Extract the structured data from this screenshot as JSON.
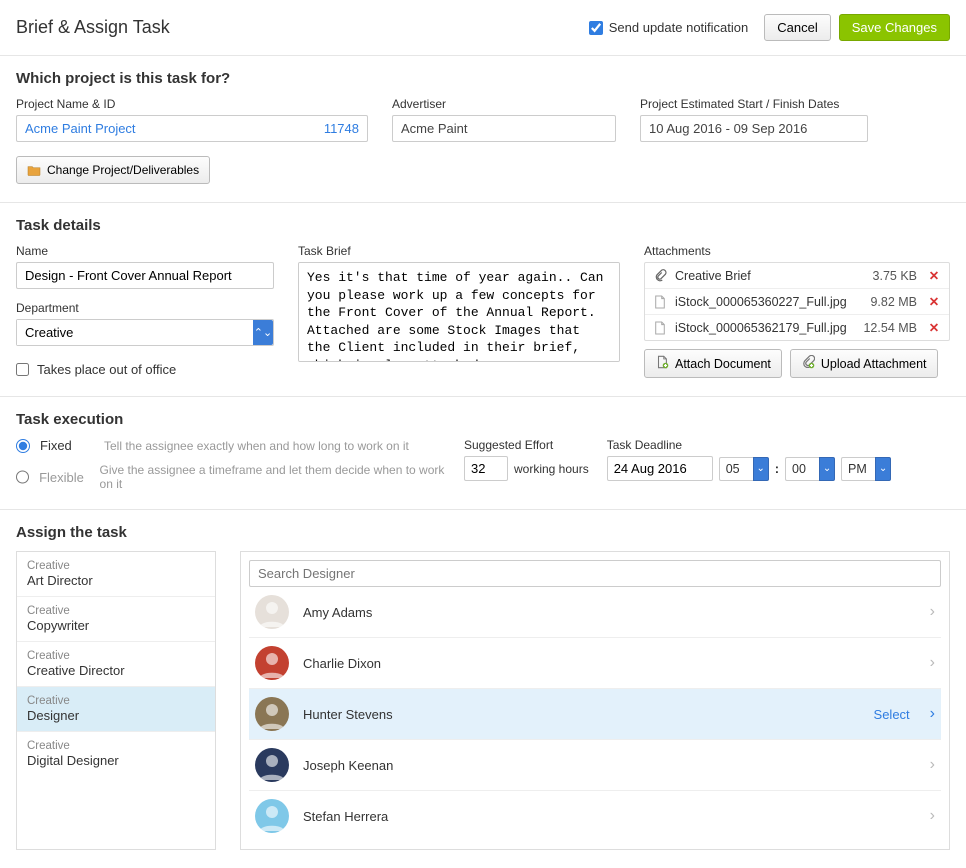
{
  "header": {
    "title": "Brief & Assign Task",
    "notify_label": "Send update notification",
    "notify_checked": true,
    "cancel": "Cancel",
    "save": "Save Changes"
  },
  "project_section": {
    "heading": "Which project is this task for?",
    "name_label": "Project Name & ID",
    "project_name": "Acme Paint Project",
    "project_id": "11748",
    "advertiser_label": "Advertiser",
    "advertiser": "Acme Paint",
    "dates_label": "Project Estimated Start / Finish Dates",
    "dates": "10 Aug 2016 - 09 Sep 2016",
    "change_btn": "Change Project/Deliverables"
  },
  "details": {
    "heading": "Task details",
    "name_label": "Name",
    "name_value": "Design - Front Cover Annual Report",
    "dept_label": "Department",
    "dept_value": "Creative",
    "brief_label": "Task Brief",
    "brief_text": "Yes it's that time of year again.. Can you please work up a few concepts for the Front Cover of the Annual Report. Attached are some Stock Images that the Client included in their brief, which is also attached.\n\nWe need this by the end of next Wednesday so please callout if you need help or input. Also, don't spend more",
    "out_of_office": "Takes place out of office",
    "attachments_label": "Attachments",
    "attachments": [
      {
        "name": "Creative Brief",
        "size": "3.75 KB",
        "kind": "clip"
      },
      {
        "name": "iStock_000065360227_Full.jpg",
        "size": "9.82 MB",
        "kind": "doc"
      },
      {
        "name": "iStock_000065362179_Full.jpg",
        "size": "12.54 MB",
        "kind": "doc"
      }
    ],
    "attach_doc_btn": "Attach Document",
    "upload_btn": "Upload Attachment"
  },
  "execution": {
    "heading": "Task execution",
    "fixed_label": "Fixed",
    "fixed_desc": "Tell the assignee exactly when and how long to work on it",
    "flex_label": "Flexible",
    "flex_desc": "Give the assignee a timeframe and let them decide when to work on it",
    "effort_label": "Suggested Effort",
    "effort_value": "32",
    "effort_unit": "working hours",
    "deadline_label": "Task Deadline",
    "deadline_date": "24 Aug 2016",
    "deadline_hour": "05",
    "deadline_min": "00",
    "deadline_ampm": "PM"
  },
  "assign": {
    "heading": "Assign the task",
    "roles": [
      {
        "dept": "Creative",
        "role": "Art Director"
      },
      {
        "dept": "Creative",
        "role": "Copywriter"
      },
      {
        "dept": "Creative",
        "role": "Creative Director"
      },
      {
        "dept": "Creative",
        "role": "Designer",
        "active": true
      },
      {
        "dept": "Creative",
        "role": "Digital Designer"
      }
    ],
    "search_placeholder": "Search Designer",
    "people": [
      {
        "name": "Amy Adams",
        "avatar_color": "#e6e0da"
      },
      {
        "name": "Charlie Dixon",
        "avatar_color": "#c34130"
      },
      {
        "name": "Hunter Stevens",
        "avatar_color": "#8a7654",
        "selected": true
      },
      {
        "name": "Joseph Keenan",
        "avatar_color": "#2a3a5e"
      },
      {
        "name": "Stefan Herrera",
        "avatar_color": "#7fc8e8"
      }
    ],
    "select_label": "Select"
  }
}
